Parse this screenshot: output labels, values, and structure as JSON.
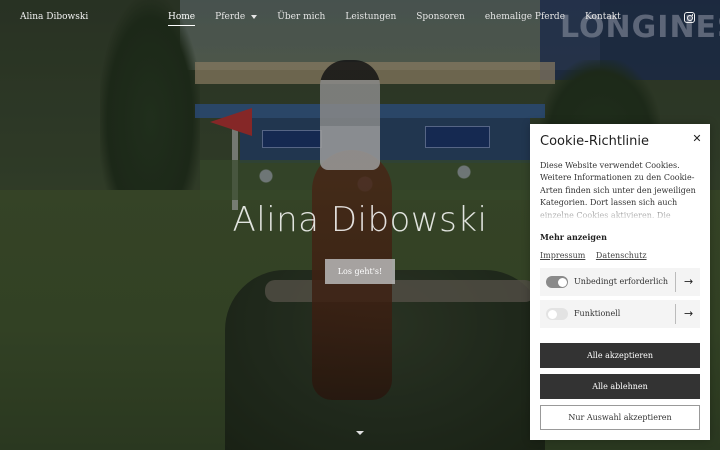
{
  "nav": {
    "brand": "Alina Dibowski",
    "items": [
      {
        "label": "Home",
        "active": true
      },
      {
        "label": "Pferde",
        "dropdown": true
      },
      {
        "label": "Über mich"
      },
      {
        "label": "Leistungen"
      },
      {
        "label": "Sponsoren"
      },
      {
        "label": "ehemalige Pferde"
      },
      {
        "label": "Kontakt"
      }
    ],
    "social_icon": "instagram-icon"
  },
  "hero": {
    "title": "Alina Dibowski",
    "cta_label": "Los geht's!",
    "background_banner_text": "LONGINES",
    "scroll_icon": "chevron-down-icon"
  },
  "cookie": {
    "title": "Cookie-Richtlinie",
    "close_icon": "close-icon",
    "text": "Diese Website verwendet Cookies. Weitere Informationen zu den Cookie-Arten finden sich unter den jeweiligen Kategorien. Dort lassen sich auch einzelne Cookies aktivieren. Die Cookie-Einstellungen können jederzeit",
    "more_label": "Mehr anzeigen",
    "links": [
      "Impressum",
      "Datenschutz"
    ],
    "categories": [
      {
        "label": "Unbedingt erforderlich",
        "enabled": true
      },
      {
        "label": "Funktionell",
        "enabled": false
      }
    ],
    "buttons": {
      "accept_all": "Alle akzeptieren",
      "reject_all": "Alle ablehnen",
      "accept_selection": "Nur Auswahl akzeptieren"
    }
  },
  "colors": {
    "button_dark": "#333333",
    "toggle_on": "#8a8a8a",
    "toggle_off": "#e3e3e3"
  }
}
